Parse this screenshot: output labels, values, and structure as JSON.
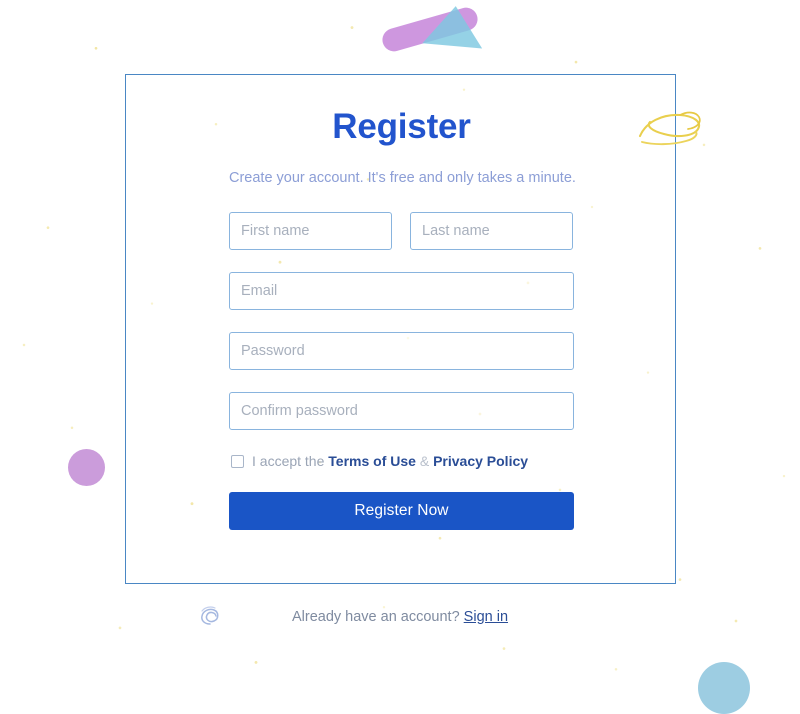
{
  "page": {
    "title": "Register",
    "subtitle": "Create your account. It's free and only takes a minute."
  },
  "form": {
    "first_name": {
      "placeholder": "First name",
      "value": ""
    },
    "last_name": {
      "placeholder": "Last name",
      "value": ""
    },
    "email": {
      "placeholder": "Email",
      "value": ""
    },
    "password": {
      "placeholder": "Password",
      "value": ""
    },
    "confirm_password": {
      "placeholder": "Confirm password",
      "value": ""
    },
    "terms": {
      "checked": false,
      "prefix": "I accept the",
      "terms_link": "Terms of Use",
      "separator": "&",
      "privacy_link": "Privacy Policy"
    },
    "submit_label": "Register Now"
  },
  "footer": {
    "prompt": "Already have an account?",
    "signin_label": "Sign in"
  },
  "decor": {
    "capsule": "purple-capsule-shape",
    "triangle": "blue-triangle-shape",
    "circle_purple": "purple-circle-shape",
    "circle_blue": "blue-circle-shape",
    "scribble": "yellow-scribble-doodle",
    "swirl": "blue-swirl-doodle"
  },
  "colors": {
    "accent_blue": "#1a55c6",
    "title_blue": "#2254cd",
    "subtitle_blue": "#8c9ed6",
    "card_border": "#4a87c4",
    "input_border": "#89b4de",
    "link_blue": "#2a4d96",
    "purple": "#c48ed6",
    "light_blue": "#8cc4dd",
    "yellow": "#e8cc4a"
  }
}
